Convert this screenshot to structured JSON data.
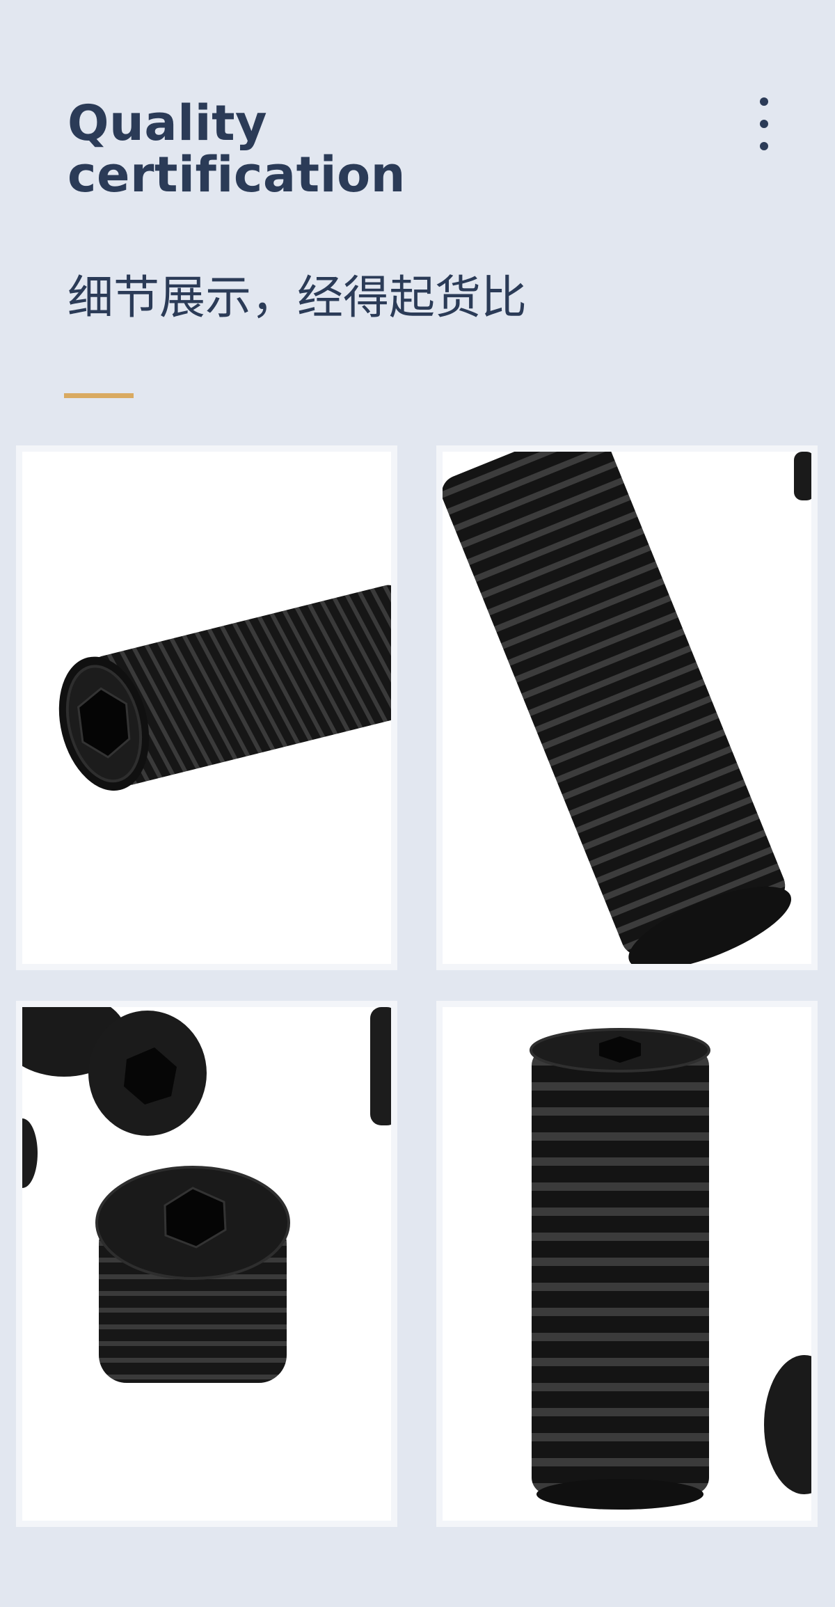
{
  "header": {
    "title_line1": "Quality",
    "title_line2": "certification",
    "subtitle": "细节展示，经得起货比",
    "menu_icon": "more-vertical-icon"
  },
  "colors": {
    "background": "#e2e7f0",
    "title": "#2b3b57",
    "accent": "#d9aa61",
    "tile_border": "#f3f5f9"
  },
  "gallery": [
    {
      "subject": "screw-side-view-photo"
    },
    {
      "subject": "screw-closeup-threads-photo"
    },
    {
      "subject": "screws-hex-socket-photo"
    },
    {
      "subject": "screw-upright-photo"
    }
  ]
}
